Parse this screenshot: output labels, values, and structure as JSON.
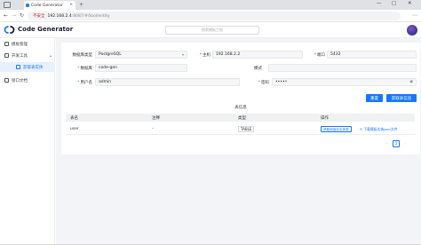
{
  "browser": {
    "tab_title": "Code Generator",
    "tab_close": "×",
    "new_tab": "+",
    "security_label": "不安全",
    "url_host": "192.168.2.4",
    "url_path": ":8087/#/tool/entity",
    "nav_back": "←",
    "nav_forward": "→",
    "nav_reload": "↻",
    "win_min": "—",
    "win_max": "□",
    "win_close": "✕",
    "menu": "⋯"
  },
  "app": {
    "brand": "Code Generator",
    "search_placeholder": "搜索模板工程"
  },
  "sidebar": {
    "items": [
      {
        "label": "模板管理",
        "icon": "template-icon"
      },
      {
        "label": "开发工具",
        "icon": "tool-icon",
        "chevron": "▴"
      },
      {
        "label": "获取表实体",
        "icon": "table-icon"
      },
      {
        "label": "接口文档",
        "icon": "doc-icon"
      }
    ]
  },
  "form": {
    "db_type_label": "数据库类型",
    "db_type_value": "PostgreSQL",
    "host_label": "主机",
    "host_value": "192.168.2.2",
    "port_label": "端口",
    "port_value": "5432",
    "database_label": "数据库",
    "database_value": "code-gen",
    "schema_label": "模式",
    "schema_value": "",
    "user_label": "用户名",
    "user_value": "admin",
    "password_label": "密码",
    "password_value": "•••••",
    "required_mark": "*",
    "select_arrow": "▾",
    "eye": "◉"
  },
  "buttons": {
    "reset": "重置",
    "fetch": "获取表信息"
  },
  "table": {
    "section_title": "表信息",
    "columns": [
      "表名",
      "注释",
      "类型",
      "操作"
    ],
    "rows": [
      {
        "name": "user",
        "comment": "-",
        "type": "TABLE",
        "action_btn": "获取和保存实体类",
        "action_link": "下载模板实体json文件"
      }
    ]
  },
  "pagination": {
    "prev": "‹",
    "current": "1",
    "next": "›"
  }
}
